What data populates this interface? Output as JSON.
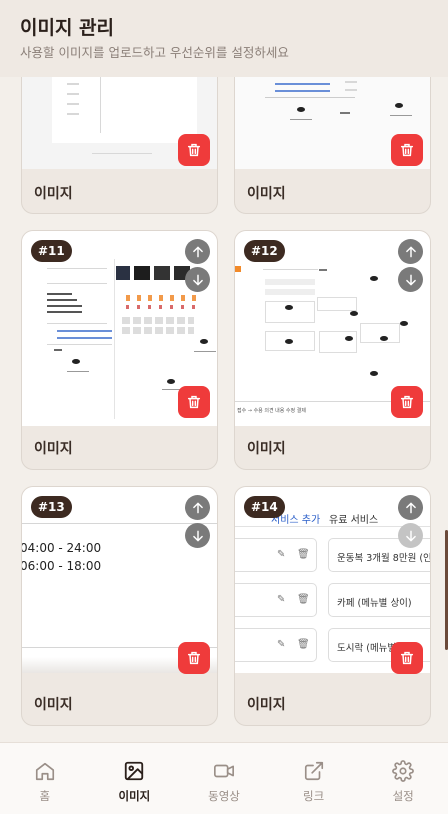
{
  "header": {
    "title": "이미지 관리",
    "subtitle": "사용할 이미지를 업로드하고 우선순위를 설정하세요"
  },
  "cards": [
    {
      "label": "이미지"
    },
    {
      "label": "이미지"
    },
    {
      "label": "이미지",
      "badge": "#11"
    },
    {
      "label": "이미지",
      "badge": "#12"
    },
    {
      "label": "이미지",
      "badge": "#13"
    },
    {
      "label": "이미지",
      "badge": "#14"
    }
  ],
  "shot13": {
    "time1": "04:00 - 24:00",
    "time2": "06:00 - 18:00"
  },
  "shot14": {
    "tab_active": "서비스 추가",
    "tab_other": "유료 서비스",
    "item1": "운동복 3개월 8만원 (인정",
    "item2": "카페 (메뉴별 상이)",
    "item3": "도시락 (메뉴별"
  },
  "shot12": {
    "footer": "접수 → 수용 의견 내용 수정 결제"
  },
  "nav": {
    "items": [
      {
        "label": "홈",
        "icon": "home-icon"
      },
      {
        "label": "이미지",
        "icon": "image-icon"
      },
      {
        "label": "동영상",
        "icon": "video-icon"
      },
      {
        "label": "링크",
        "icon": "external-link-icon"
      },
      {
        "label": "설정",
        "icon": "gear-icon"
      }
    ],
    "active": "이미지"
  },
  "colors": {
    "accent": "#3d2a21",
    "delete": "#ef3b3b",
    "background": "#f3efea"
  }
}
